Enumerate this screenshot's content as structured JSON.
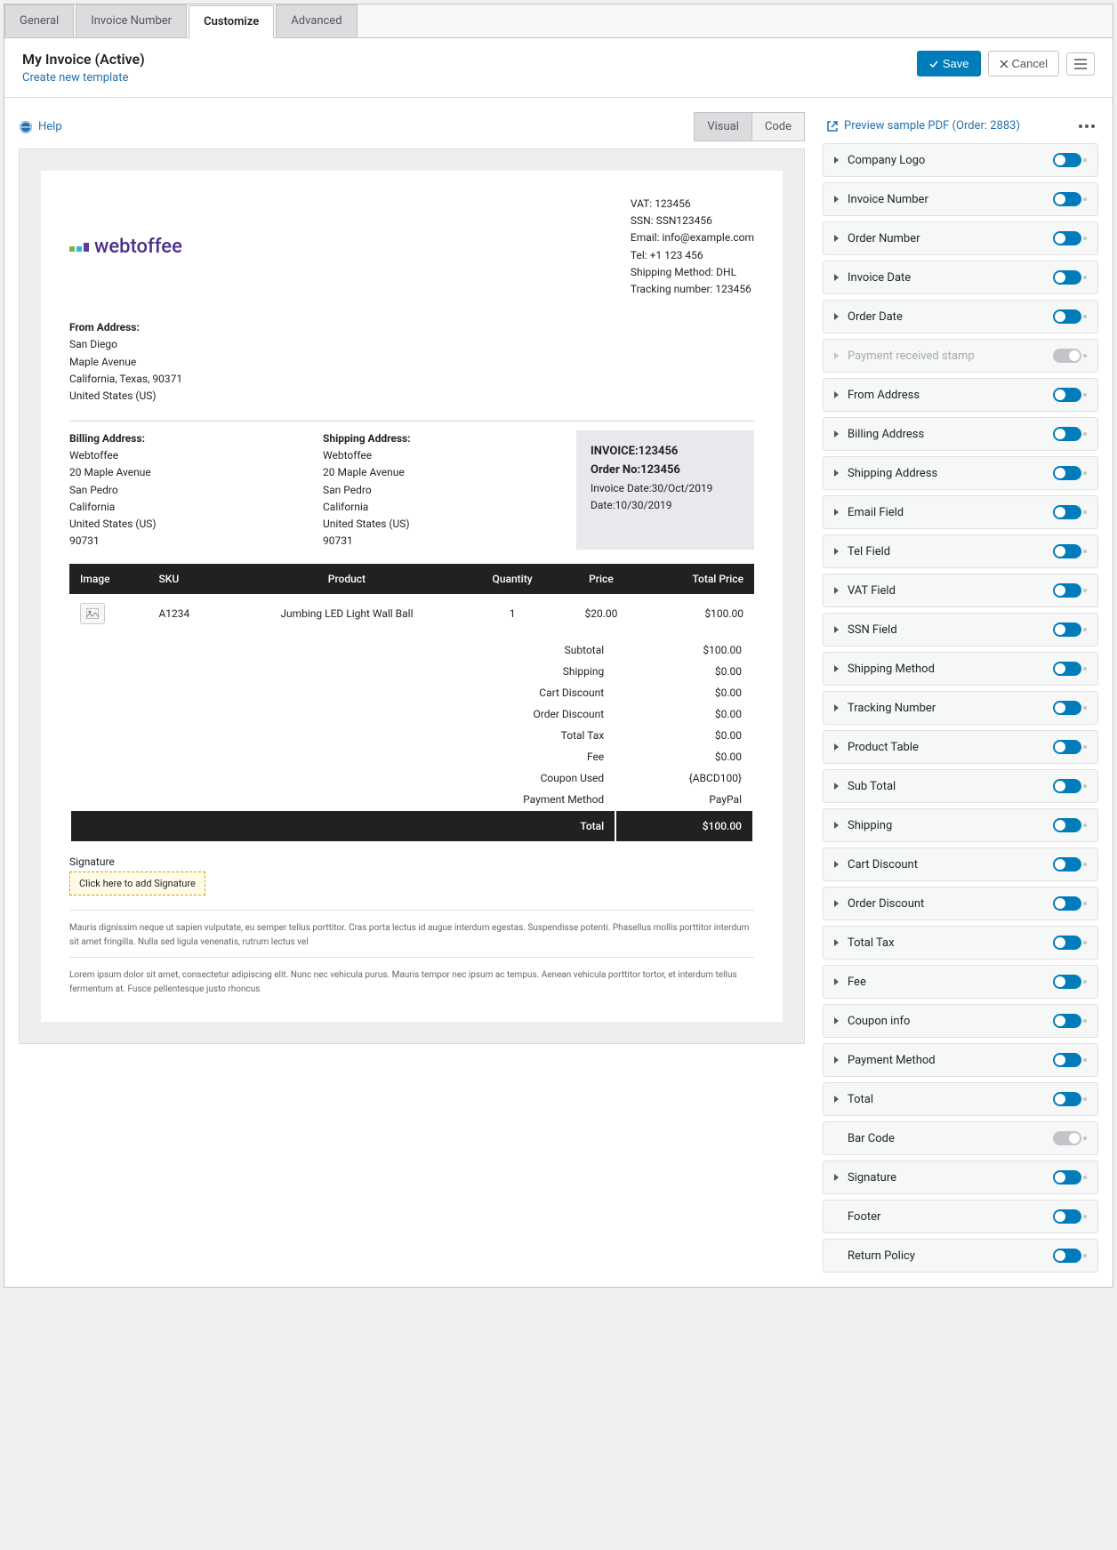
{
  "tabs": [
    "General",
    "Invoice Number",
    "Customize",
    "Advanced"
  ],
  "active_tab": 2,
  "header": {
    "title": "My Invoice (Active)",
    "create_link": "Create new template",
    "save": "Save",
    "cancel": "Cancel"
  },
  "help": "Help",
  "view_tabs": {
    "visual": "Visual",
    "code": "Code"
  },
  "preview_link": "Preview sample PDF (Order: 2883)",
  "invoice": {
    "logo_text": "webtoffee",
    "company": {
      "vat": "VAT: 123456",
      "ssn": "SSN: SSN123456",
      "email": "Email: info@example.com",
      "tel": "Tel: +1 123 456",
      "shipping_method": "Shipping Method: DHL",
      "tracking": "Tracking number: 123456"
    },
    "from": {
      "title": "From Address:",
      "l1": "San Diego",
      "l2": "Maple Avenue",
      "l3": "California, Texas, 90371",
      "l4": "United States (US)"
    },
    "billing": {
      "title": "Billing Address:",
      "l1": "Webtoffee",
      "l2": "20 Maple Avenue",
      "l3": "San Pedro",
      "l4": "California",
      "l5": "United States (US)",
      "l6": "90731"
    },
    "shipping": {
      "title": "Shipping Address:",
      "l1": "Webtoffee",
      "l2": "20 Maple Avenue",
      "l3": "San Pedro",
      "l4": "California",
      "l5": "United States (US)",
      "l6": "90731"
    },
    "meta": {
      "invoice_no": "INVOICE:123456",
      "order_no": "Order No:123456",
      "invoice_date": "Invoice Date:30/Oct/2019",
      "date": "Date:10/30/2019"
    },
    "table_headers": {
      "image": "Image",
      "sku": "SKU",
      "product": "Product",
      "qty": "Quantity",
      "price": "Price",
      "total": "Total Price"
    },
    "row": {
      "sku": "A1234",
      "product": "Jumbing LED Light Wall Ball",
      "qty": "1",
      "price": "$20.00",
      "total": "$100.00"
    },
    "totals": [
      {
        "label": "Subtotal",
        "value": "$100.00"
      },
      {
        "label": "Shipping",
        "value": "$0.00"
      },
      {
        "label": "Cart Discount",
        "value": "$0.00"
      },
      {
        "label": "Order Discount",
        "value": "$0.00"
      },
      {
        "label": "Total Tax",
        "value": "$0.00"
      },
      {
        "label": "Fee",
        "value": "$0.00"
      },
      {
        "label": "Coupon Used",
        "value": "{ABCD100}"
      },
      {
        "label": "Payment Method",
        "value": "PayPal"
      }
    ],
    "grand_total": {
      "label": "Total",
      "value": "$100.00"
    },
    "signature": {
      "label": "Signature",
      "placeholder": "Click here to add Signature"
    },
    "footer1": "Mauris dignissim neque ut sapien vulputate, eu semper tellus porttitor. Cras porta lectus id augue interdum egestas. Suspendisse potenti. Phasellus mollis porttitor interdum sit amet fringilla. Nulla sed ligula venenatis, rutrum lectus vel",
    "footer2": "Lorem ipsum dolor sit amet, consectetur adipiscing elit. Nunc nec vehicula purus. Mauris tempor nec ipsum ac tempus. Aenean vehicula porttitor tortor, et interdum tellus fermentum at. Fusce pellentesque justo rhoncus"
  },
  "options": [
    {
      "label": "Company Logo",
      "on": true,
      "chev": true
    },
    {
      "label": "Invoice Number",
      "on": true,
      "chev": true
    },
    {
      "label": "Order Number",
      "on": true,
      "chev": true
    },
    {
      "label": "Invoice Date",
      "on": true,
      "chev": true
    },
    {
      "label": "Order Date",
      "on": true,
      "chev": true
    },
    {
      "label": "Payment received stamp",
      "on": false,
      "chev": true,
      "disabled": true
    },
    {
      "label": "From Address",
      "on": true,
      "chev": true
    },
    {
      "label": "Billing Address",
      "on": true,
      "chev": true
    },
    {
      "label": "Shipping Address",
      "on": true,
      "chev": true
    },
    {
      "label": "Email Field",
      "on": true,
      "chev": true
    },
    {
      "label": "Tel Field",
      "on": true,
      "chev": true
    },
    {
      "label": "VAT Field",
      "on": true,
      "chev": true
    },
    {
      "label": "SSN Field",
      "on": true,
      "chev": true
    },
    {
      "label": "Shipping Method",
      "on": true,
      "chev": true
    },
    {
      "label": "Tracking Number",
      "on": true,
      "chev": true
    },
    {
      "label": "Product Table",
      "on": true,
      "chev": true
    },
    {
      "label": "Sub Total",
      "on": true,
      "chev": true
    },
    {
      "label": "Shipping",
      "on": true,
      "chev": true
    },
    {
      "label": "Cart Discount",
      "on": true,
      "chev": true
    },
    {
      "label": "Order Discount",
      "on": true,
      "chev": true
    },
    {
      "label": "Total Tax",
      "on": true,
      "chev": true
    },
    {
      "label": "Fee",
      "on": true,
      "chev": true
    },
    {
      "label": "Coupon info",
      "on": true,
      "chev": true
    },
    {
      "label": "Payment Method",
      "on": true,
      "chev": true
    },
    {
      "label": "Total",
      "on": true,
      "chev": true
    },
    {
      "label": "Bar Code",
      "on": false,
      "chev": false
    },
    {
      "label": "Signature",
      "on": true,
      "chev": true
    },
    {
      "label": "Footer",
      "on": true,
      "chev": false
    },
    {
      "label": "Return Policy",
      "on": true,
      "chev": false
    }
  ]
}
